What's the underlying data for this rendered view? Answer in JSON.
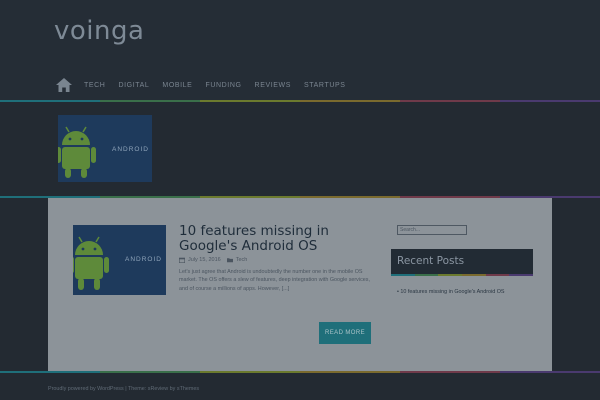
{
  "site": {
    "title": "voinga"
  },
  "nav": {
    "home_icon": "home-icon",
    "items": [
      "TECH",
      "DIGITAL",
      "MOBILE",
      "FUNDING",
      "REVIEWS",
      "STARTUPS"
    ]
  },
  "colors": {
    "stripe": [
      "#1f6f7a",
      "#3a6f4a",
      "#6b7a2e",
      "#7a6a2e",
      "#6f3a4a",
      "#4a3a6f"
    ],
    "accent": "#1f6f7a",
    "content_bg": "#8c9399",
    "page_bg": "#232a32"
  },
  "banner": {
    "image_text": "ANDROID"
  },
  "post": {
    "title": "10 features missing in Google's Android OS",
    "date": "July 15, 2016",
    "category": "Tech",
    "image_text": "ANDROID",
    "excerpt": "Let's just agree that Android is undoubtedly the number one in the mobile OS market. The OS offers a slew of features, deep integration with Google services, and of course a millions of apps. However, [...]",
    "read_more": "READ MORE"
  },
  "sidebar": {
    "search_placeholder": "Search...",
    "widget_title": "Recent Posts",
    "recent_posts": [
      "10 features missing in Google's Android OS"
    ]
  },
  "footer": {
    "powered_by": "Proudly powered by WordPress",
    "separator": "|",
    "theme_label": "Theme:",
    "theme_name": "sReview",
    "by_label": "by",
    "author": "sThemes"
  }
}
